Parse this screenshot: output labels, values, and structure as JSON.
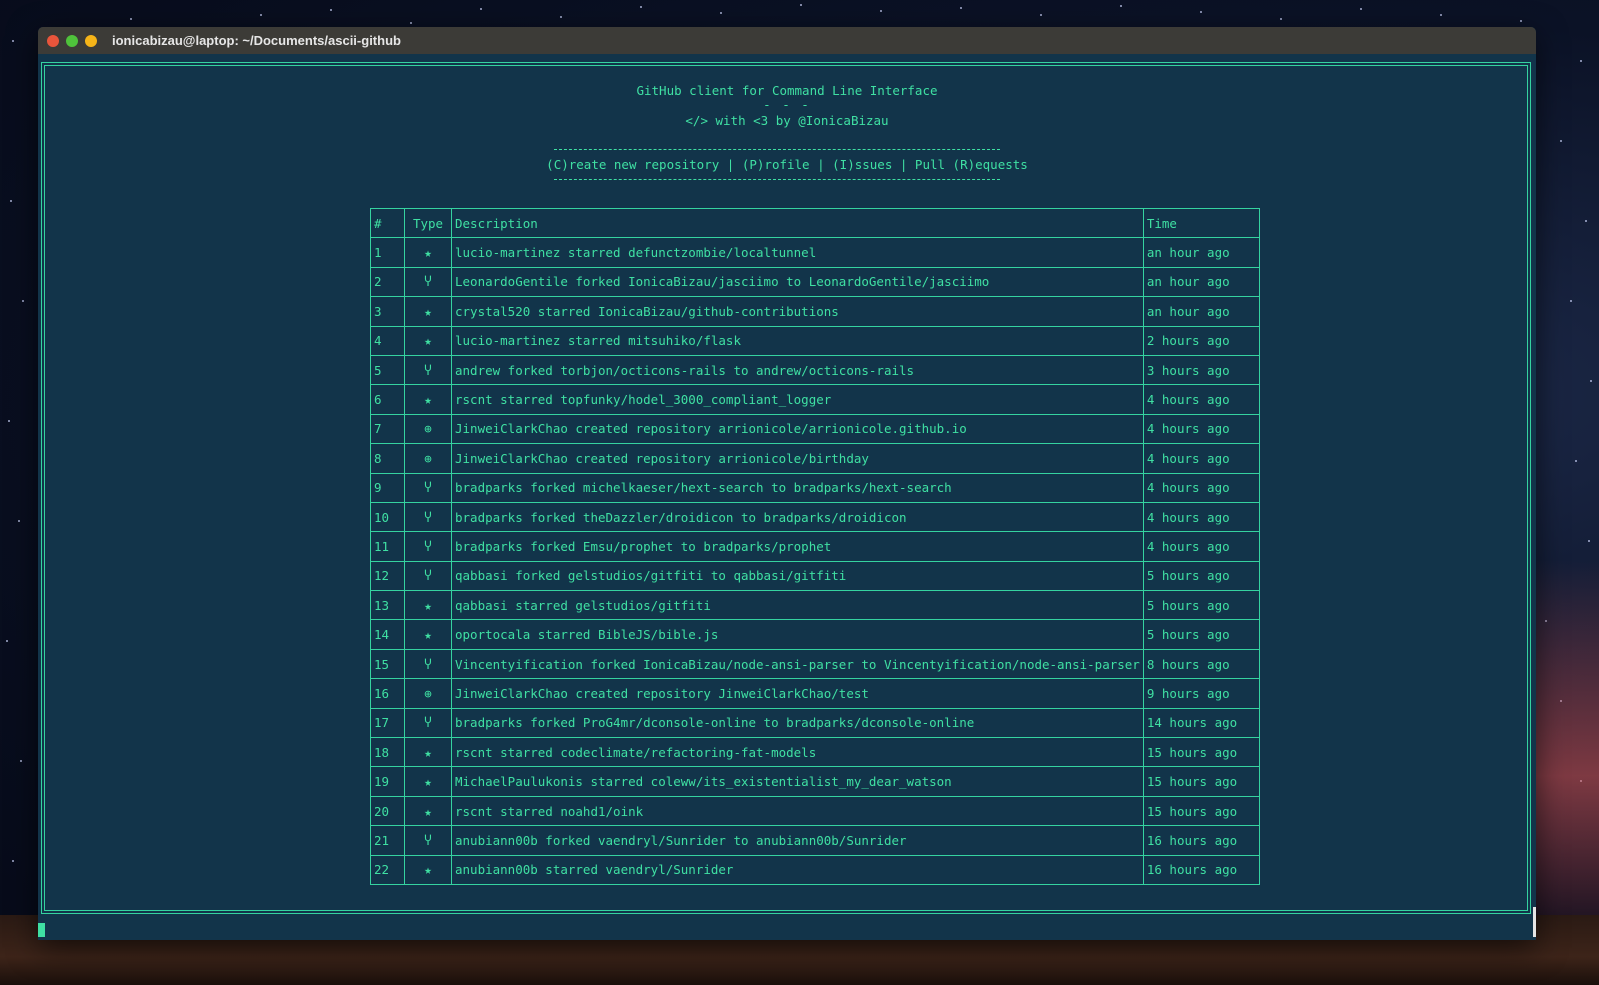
{
  "window": {
    "title": "ionicabizau@laptop: ~/Documents/ascii-github"
  },
  "header": {
    "line1": "GitHub client for Command Line Interface",
    "line2": "- - -",
    "line3": "</> with <3 by @IonicaBizau",
    "menu": "(C)reate new repository | (P)rofile | (I)ssues | Pull (R)equests"
  },
  "table": {
    "columns": [
      "#",
      "Type",
      "Description",
      "Time"
    ],
    "rows": [
      {
        "num": "1",
        "type": "★",
        "desc": "lucio-martinez starred defunctzombie/localtunnel",
        "time": "an hour ago"
      },
      {
        "num": "2",
        "type": "Ⴤ",
        "desc": "LeonardoGentile forked IonicaBizau/jasciimo to LeonardoGentile/jasciimo",
        "time": "an hour ago"
      },
      {
        "num": "3",
        "type": "★",
        "desc": "crystal520 starred IonicaBizau/github-contributions",
        "time": "an hour ago"
      },
      {
        "num": "4",
        "type": "★",
        "desc": "lucio-martinez starred mitsuhiko/flask",
        "time": "2 hours ago"
      },
      {
        "num": "5",
        "type": "Ⴤ",
        "desc": "andrew forked torbjon/octicons-rails to andrew/octicons-rails",
        "time": "3 hours ago"
      },
      {
        "num": "6",
        "type": "★",
        "desc": "rscnt starred topfunky/hodel_3000_compliant_logger",
        "time": "4 hours ago"
      },
      {
        "num": "7",
        "type": "⊕",
        "desc": "JinweiClarkChao created repository arrionicole/arrionicole.github.io",
        "time": "4 hours ago"
      },
      {
        "num": "8",
        "type": "⊕",
        "desc": "JinweiClarkChao created repository arrionicole/birthday",
        "time": "4 hours ago"
      },
      {
        "num": "9",
        "type": "Ⴤ",
        "desc": "bradparks forked michelkaeser/hext-search to bradparks/hext-search",
        "time": "4 hours ago"
      },
      {
        "num": "10",
        "type": "Ⴤ",
        "desc": "bradparks forked theDazzler/droidicon to bradparks/droidicon",
        "time": "4 hours ago"
      },
      {
        "num": "11",
        "type": "Ⴤ",
        "desc": "bradparks forked Emsu/prophet to bradparks/prophet",
        "time": "4 hours ago"
      },
      {
        "num": "12",
        "type": "Ⴤ",
        "desc": "qabbasi forked gelstudios/gitfiti to qabbasi/gitfiti",
        "time": "5 hours ago"
      },
      {
        "num": "13",
        "type": "★",
        "desc": "qabbasi starred gelstudios/gitfiti",
        "time": "5 hours ago"
      },
      {
        "num": "14",
        "type": "★",
        "desc": "oportocala starred BibleJS/bible.js",
        "time": "5 hours ago"
      },
      {
        "num": "15",
        "type": "Ⴤ",
        "desc": "Vincentyification forked IonicaBizau/node-ansi-parser to Vincentyification/node-ansi-parser",
        "time": "8 hours ago"
      },
      {
        "num": "16",
        "type": "⊕",
        "desc": "JinweiClarkChao created repository JinweiClarkChao/test",
        "time": "9 hours ago"
      },
      {
        "num": "17",
        "type": "Ⴤ",
        "desc": "bradparks forked ProG4mr/dconsole-online to bradparks/dconsole-online",
        "time": "14 hours ago"
      },
      {
        "num": "18",
        "type": "★",
        "desc": "rscnt starred codeclimate/refactoring-fat-models",
        "time": "15 hours ago"
      },
      {
        "num": "19",
        "type": "★",
        "desc": "MichaelPaulukonis starred coleww/its_existentialist_my_dear_watson",
        "time": "15 hours ago"
      },
      {
        "num": "20",
        "type": "★",
        "desc": "rscnt starred noahd1/oink",
        "time": "15 hours ago"
      },
      {
        "num": "21",
        "type": "Ⴤ",
        "desc": "anubiann00b forked vaendryl/Sunrider to anubiann00b/Sunrider",
        "time": "16 hours ago"
      },
      {
        "num": "22",
        "type": "★",
        "desc": "anubiann00b starred vaendryl/Sunrider",
        "time": "16 hours ago"
      }
    ]
  },
  "colors": {
    "terminal_bg": "#12344a",
    "accent": "#3fe0a3"
  }
}
